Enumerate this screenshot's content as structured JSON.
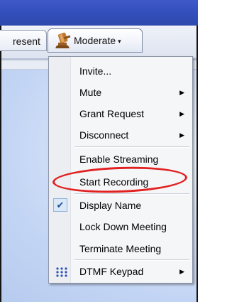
{
  "toolbar": {
    "present_tab_label": "resent",
    "moderate_tab_label": "Moderate",
    "moderate_tab_icon": "gavel-icon",
    "moderate_caret": "▾"
  },
  "menu": {
    "items": [
      {
        "label": "Invite...",
        "has_submenu": false
      },
      {
        "label": "Mute",
        "has_submenu": true
      },
      {
        "label": "Grant Request",
        "has_submenu": true
      },
      {
        "label": "Disconnect",
        "has_submenu": true
      },
      {
        "label": "Enable Streaming",
        "has_submenu": false
      },
      {
        "label": "Start Recording",
        "has_submenu": false,
        "highlighted": true
      },
      {
        "label": "Display Name",
        "has_submenu": false,
        "checked": true
      },
      {
        "label": "Lock Down Meeting",
        "has_submenu": false
      },
      {
        "label": "Terminate Meeting",
        "has_submenu": false
      },
      {
        "label": "DTMF Keypad",
        "has_submenu": true,
        "icon": "keypad-icon"
      }
    ],
    "submenu_arrow": "▶",
    "check_mark": "✔"
  },
  "colors": {
    "title_bar": "#3350bd",
    "highlight_ring": "#e12020",
    "content_background": "#c3d5f4"
  }
}
